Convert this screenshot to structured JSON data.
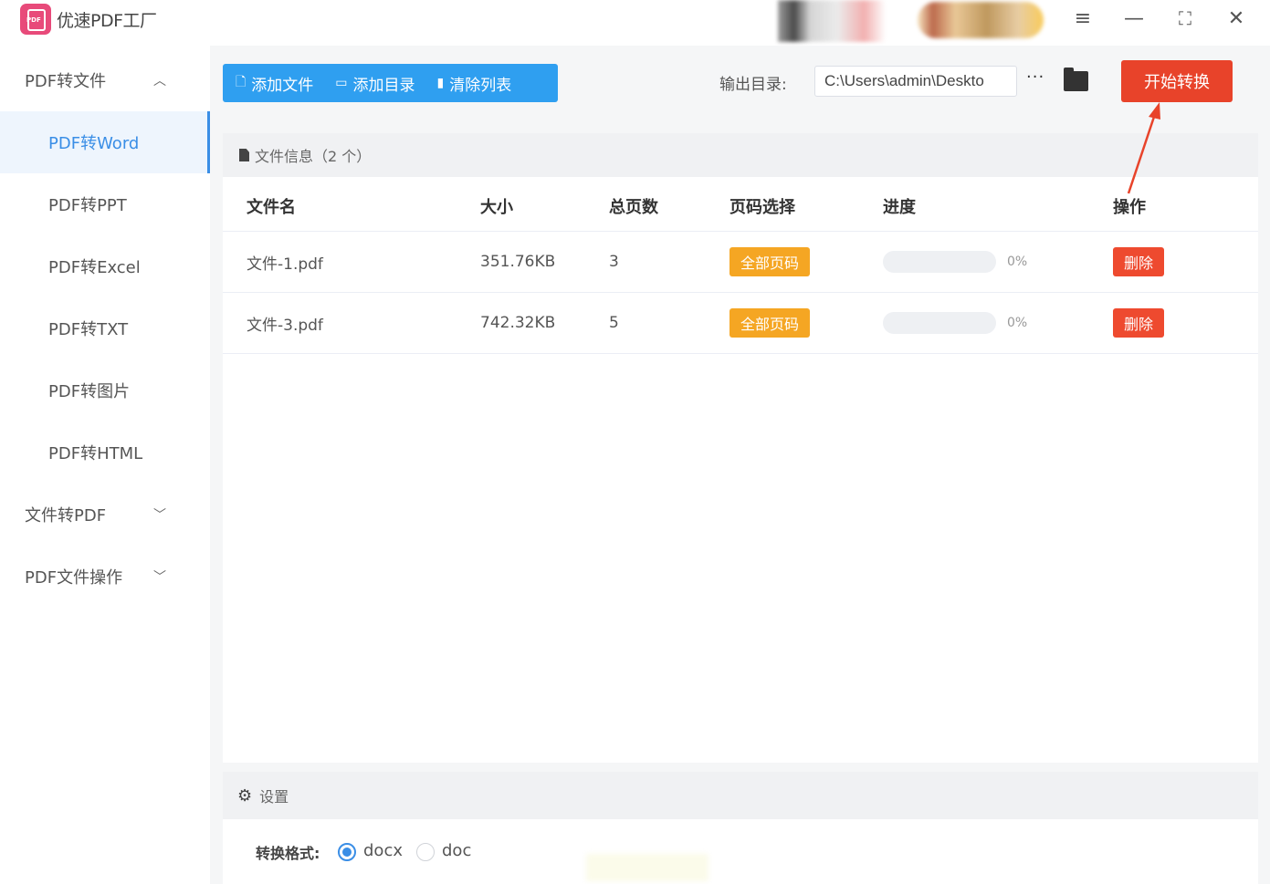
{
  "app": {
    "title": "优速PDF工厂"
  },
  "window_controls": {
    "menu_icon": "menu-icon",
    "minimize_icon": "minimize-icon",
    "maximize_icon": "maximize-icon",
    "close_icon": "close-icon"
  },
  "sidebar": {
    "groups": [
      {
        "label": "PDF转文件",
        "expanded": true,
        "items": [
          {
            "label": "PDF转Word",
            "active": true
          },
          {
            "label": "PDF转PPT"
          },
          {
            "label": "PDF转Excel"
          },
          {
            "label": "PDF转TXT"
          },
          {
            "label": "PDF转图片"
          },
          {
            "label": "PDF转HTML"
          }
        ]
      },
      {
        "label": "文件转PDF",
        "expanded": false
      },
      {
        "label": "PDF文件操作",
        "expanded": false
      }
    ]
  },
  "toolbar": {
    "add_file": "添加文件",
    "add_folder": "添加目录",
    "clear_list": "清除列表"
  },
  "output": {
    "label": "输出目录:",
    "path": "C:\\Users\\admin\\Deskto",
    "more": "···"
  },
  "start_button": "开始转换",
  "file_panel": {
    "header": "文件信息（2 个）",
    "columns": [
      "文件名",
      "大小",
      "总页数",
      "页码选择",
      "进度",
      "操作"
    ],
    "rows": [
      {
        "name": "文件-1.pdf",
        "size": "351.76KB",
        "pages": "3",
        "page_select": "全部页码",
        "progress": 0,
        "progress_text": "0%",
        "action": "删除"
      },
      {
        "name": "文件-3.pdf",
        "size": "742.32KB",
        "pages": "5",
        "page_select": "全部页码",
        "progress": 0,
        "progress_text": "0%",
        "action": "删除"
      }
    ]
  },
  "settings": {
    "header": "设置",
    "format_label": "转换格式:",
    "formats": [
      {
        "label": "docx",
        "selected": true
      },
      {
        "label": "doc",
        "selected": false
      }
    ]
  },
  "colors": {
    "primary": "#2f9ff0",
    "accent_blue": "#3a8ee6",
    "danger": "#ee4a2f",
    "start": "#e8432a",
    "warning": "#f5a623",
    "annotation_arrow": "#e8432a"
  }
}
